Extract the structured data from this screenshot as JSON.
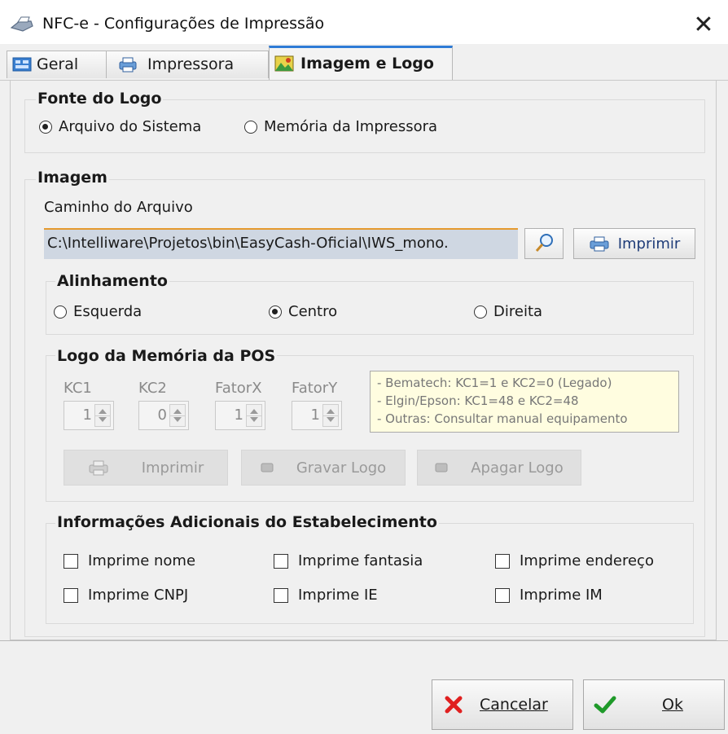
{
  "window": {
    "title": "NFC-e - Configurações de Impressão",
    "close": "✕"
  },
  "tabs": [
    {
      "label": "Geral",
      "icon": "settings-grid-icon"
    },
    {
      "label": "Impressora",
      "icon": "printer-icon"
    },
    {
      "label": "Imagem e Logo",
      "icon": "image-icon",
      "active": true
    }
  ],
  "fonte_logo": {
    "title": "Fonte do Logo",
    "options": [
      {
        "label": "Arquivo do Sistema",
        "selected": true
      },
      {
        "label": "Memória da Impressora",
        "selected": false
      }
    ]
  },
  "imagem": {
    "title": "Imagem",
    "path_label": "Caminho do Arquivo",
    "path_value": "C:\\Intelliware\\Projetos\\bin\\EasyCash-Oficial\\IWS_mono.",
    "print_button": "Imprimir",
    "alinhamento": {
      "title": "Alinhamento",
      "options": [
        {
          "label": "Esquerda",
          "selected": false
        },
        {
          "label": "Centro",
          "selected": true
        },
        {
          "label": "Direita",
          "selected": false
        }
      ]
    },
    "logo_memoria": {
      "title": "Logo da Memória da POS",
      "spinners": [
        {
          "label": "KC1",
          "value": "1"
        },
        {
          "label": "KC2",
          "value": "0"
        },
        {
          "label": "FatorX",
          "value": "1"
        },
        {
          "label": "FatorY",
          "value": "1"
        }
      ],
      "hints": [
        "- Bematech: KC1=1 e KC2=0 (Legado)",
        "- Elgin/Epson: KC1=48 e KC2=48",
        "- Outras: Consultar manual equipamento"
      ],
      "buttons": {
        "imprimir": "Imprimir",
        "gravar": "Gravar Logo",
        "apagar": "Apagar Logo"
      }
    }
  },
  "info_adicionais": {
    "title": "Informações Adicionais do Estabelecimento",
    "checks": [
      {
        "label": "Imprime nome",
        "checked": false
      },
      {
        "label": "Imprime fantasia",
        "checked": false
      },
      {
        "label": "Imprime endereço",
        "checked": false
      },
      {
        "label": "Imprime CNPJ",
        "checked": false
      },
      {
        "label": "Imprime IE",
        "checked": false
      },
      {
        "label": "Imprime IM",
        "checked": false
      }
    ]
  },
  "footer": {
    "cancel": "Cancelar",
    "ok": "Ok"
  },
  "colors": {
    "accent_tab": "#2e7bd6",
    "input_border": "#e59a2e",
    "cancel_x": "#e02020",
    "ok_check": "#1f9a2a"
  }
}
